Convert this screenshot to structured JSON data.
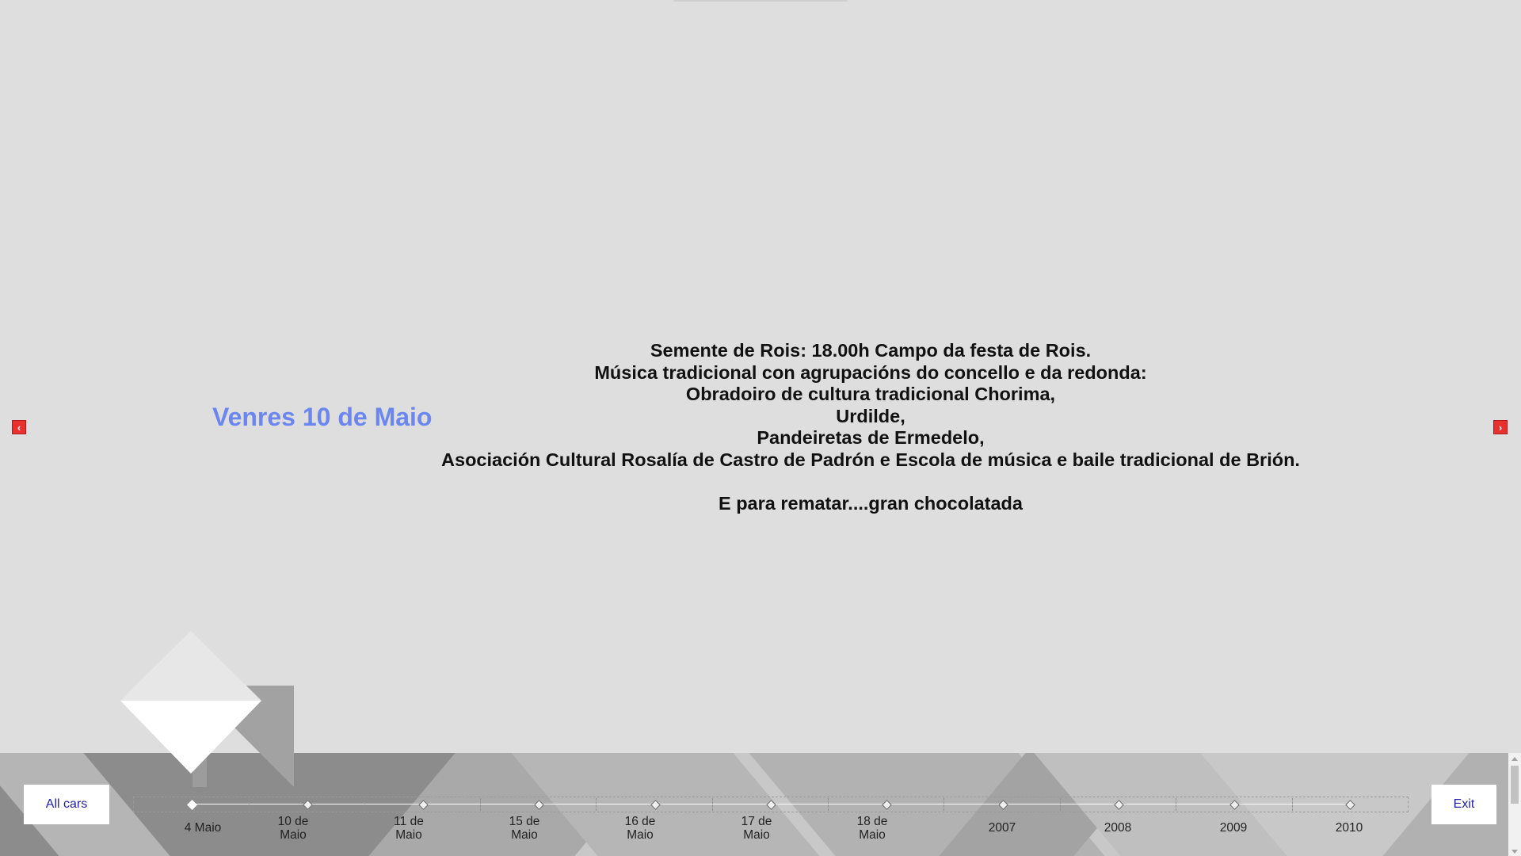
{
  "event": {
    "title": "Venres 10 de Maio",
    "lines": [
      "Semente de Rois: 18.00h Campo da festa de Rois.",
      "Música tradicional con agrupacións do concello e da redonda:",
      "Obradoiro de cultura tradicional Chorima,",
      "Urdilde,",
      "Pandeiretas de Ermedelo,",
      "Asociación Cultural Rosalía de Castro de Padrón e Escola de música e baile tradicional de Brión."
    ],
    "closing": "E para rematar....gran chocolatada"
  },
  "nav": {
    "prev_icon": "arrow-left-icon",
    "next_icon": "arrow-right-icon",
    "prev_glyph": "‹",
    "next_glyph": "›",
    "accent_color": "#e8312f"
  },
  "buttons": {
    "all_label": "All cars",
    "exit_label": "Exit"
  },
  "timeline": {
    "items": [
      {
        "l1": "4 Maio",
        "l2": "",
        "active": true
      },
      {
        "l1": "10 de",
        "l2": "Maio",
        "active": false
      },
      {
        "l1": "11 de",
        "l2": "Maio",
        "active": false
      },
      {
        "l1": "15 de",
        "l2": "Maio",
        "active": false
      },
      {
        "l1": "16 de",
        "l2": "Maio",
        "active": false
      },
      {
        "l1": "17 de",
        "l2": "Maio",
        "active": false
      },
      {
        "l1": "18 de",
        "l2": "Maio",
        "active": false
      },
      {
        "l1": "2007",
        "l2": "",
        "active": false
      },
      {
        "l1": "2008",
        "l2": "",
        "active": false
      },
      {
        "l1": "2009",
        "l2": "",
        "active": false
      },
      {
        "l1": "2010",
        "l2": "",
        "active": false
      }
    ]
  },
  "colors": {
    "title": "#6b86f0",
    "background": "#dedede"
  }
}
